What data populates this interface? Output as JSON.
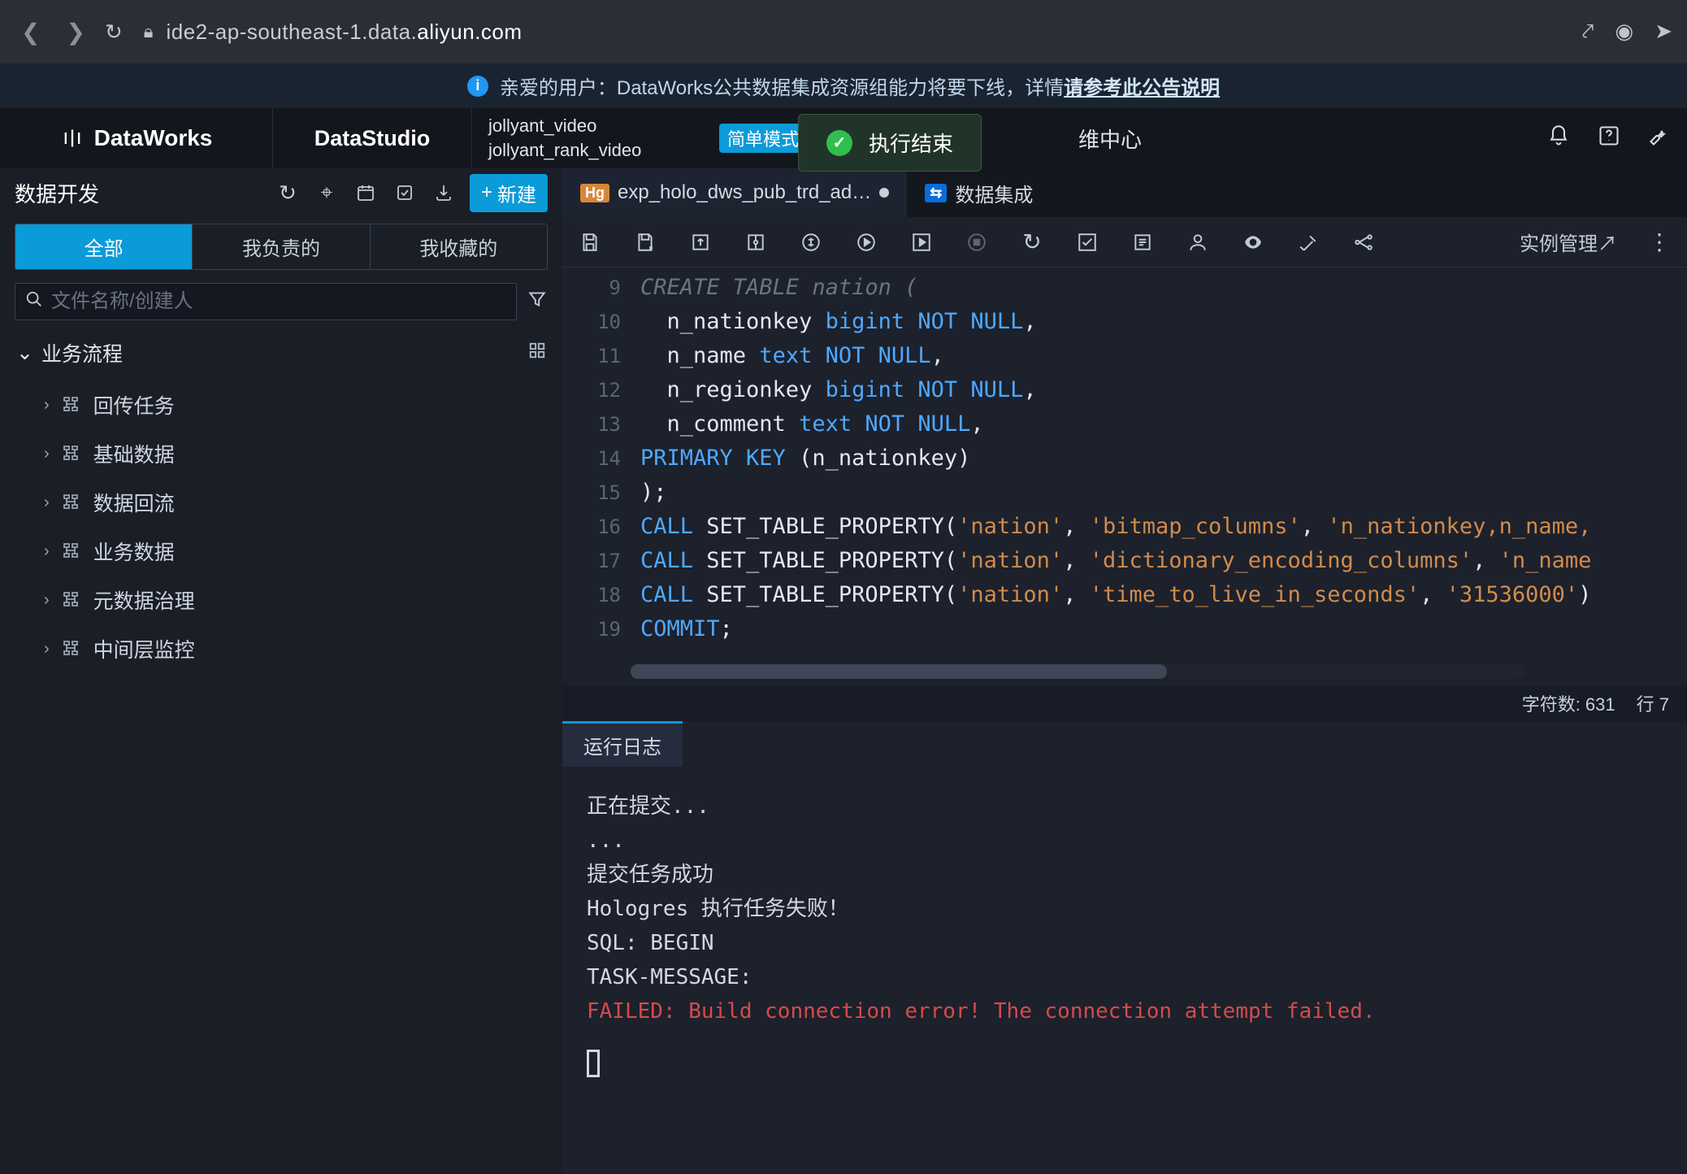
{
  "browser": {
    "url_prefix": "ide2-ap-southeast-1.data.",
    "url_domain": "aliyun.com"
  },
  "notice": {
    "prefix": "亲爱的用户：DataWorks公共数据集成资源组能力将要下线，详情",
    "link": "请参考此公告说明"
  },
  "header": {
    "brand": "DataWorks",
    "studio": "DataStudio",
    "project_line1": "jollyant_video",
    "project_line2": "jollyant_rank_video",
    "mode": "简单模式",
    "nav_center": "维中心"
  },
  "toast": "执行结束",
  "sidebar": {
    "title": "数据开发",
    "new_btn": "新建",
    "tabs": {
      "all": "全部",
      "mine": "我负责的",
      "fav": "我收藏的"
    },
    "search_placeholder": "文件名称/创建人",
    "tree_title": "业务流程",
    "items": [
      {
        "label": "回传任务"
      },
      {
        "label": "基础数据"
      },
      {
        "label": "数据回流"
      },
      {
        "label": "业务数据"
      },
      {
        "label": "元数据治理"
      },
      {
        "label": "中间层监控"
      }
    ]
  },
  "tabs": {
    "file1": "exp_holo_dws_pub_trd_ad…",
    "file1_badge": "Hg",
    "file2": "数据集成"
  },
  "editor": {
    "instance_link": "实例管理↗",
    "lines": [
      {
        "n": "9",
        "segs": [
          {
            "t": "fade",
            "v": "CREATE TABLE nation ("
          }
        ]
      },
      {
        "n": "10",
        "segs": [
          {
            "t": "id",
            "v": "  n_nationkey "
          },
          {
            "t": "kw",
            "v": "bigint "
          },
          {
            "t": "kw",
            "v": "NOT NULL"
          },
          {
            "t": "pun",
            "v": ","
          }
        ]
      },
      {
        "n": "11",
        "segs": [
          {
            "t": "id",
            "v": "  n_name "
          },
          {
            "t": "kw",
            "v": "text "
          },
          {
            "t": "kw",
            "v": "NOT NULL"
          },
          {
            "t": "pun",
            "v": ","
          }
        ]
      },
      {
        "n": "12",
        "segs": [
          {
            "t": "id",
            "v": "  n_regionkey "
          },
          {
            "t": "kw",
            "v": "bigint "
          },
          {
            "t": "kw",
            "v": "NOT NULL"
          },
          {
            "t": "pun",
            "v": ","
          }
        ]
      },
      {
        "n": "13",
        "segs": [
          {
            "t": "id",
            "v": "  n_comment "
          },
          {
            "t": "kw",
            "v": "text "
          },
          {
            "t": "kw",
            "v": "NOT NULL"
          },
          {
            "t": "pun",
            "v": ","
          }
        ]
      },
      {
        "n": "14",
        "segs": [
          {
            "t": "kw",
            "v": "PRIMARY KEY "
          },
          {
            "t": "pun",
            "v": "(n_nationkey)"
          }
        ]
      },
      {
        "n": "15",
        "segs": [
          {
            "t": "pun",
            "v": ");"
          }
        ]
      },
      {
        "n": "16",
        "segs": [
          {
            "t": "kw",
            "v": "CALL "
          },
          {
            "t": "id",
            "v": "SET_TABLE_PROPERTY("
          },
          {
            "t": "str",
            "v": "'nation'"
          },
          {
            "t": "pun",
            "v": ", "
          },
          {
            "t": "str",
            "v": "'bitmap_columns'"
          },
          {
            "t": "pun",
            "v": ", "
          },
          {
            "t": "str",
            "v": "'n_nationkey,n_name,"
          }
        ]
      },
      {
        "n": "17",
        "segs": [
          {
            "t": "kw",
            "v": "CALL "
          },
          {
            "t": "id",
            "v": "SET_TABLE_PROPERTY("
          },
          {
            "t": "str",
            "v": "'nation'"
          },
          {
            "t": "pun",
            "v": ", "
          },
          {
            "t": "str",
            "v": "'dictionary_encoding_columns'"
          },
          {
            "t": "pun",
            "v": ", "
          },
          {
            "t": "str",
            "v": "'n_name"
          }
        ]
      },
      {
        "n": "18",
        "segs": [
          {
            "t": "kw",
            "v": "CALL "
          },
          {
            "t": "id",
            "v": "SET_TABLE_PROPERTY("
          },
          {
            "t": "str",
            "v": "'nation'"
          },
          {
            "t": "pun",
            "v": ", "
          },
          {
            "t": "str",
            "v": "'time_to_live_in_seconds'"
          },
          {
            "t": "pun",
            "v": ", "
          },
          {
            "t": "str",
            "v": "'31536000'"
          },
          {
            "t": "pun",
            "v": ")"
          }
        ]
      },
      {
        "n": "19",
        "segs": [
          {
            "t": "kw",
            "v": "COMMIT"
          },
          {
            "t": "pun",
            "v": ";"
          }
        ]
      }
    ],
    "status_chars": "字符数: 631",
    "status_row": "行 7"
  },
  "console": {
    "tab": "运行日志",
    "lines": [
      {
        "cls": "",
        "text": "正在提交..."
      },
      {
        "cls": "",
        "text": "..."
      },
      {
        "cls": "",
        "text": "提交任务成功"
      },
      {
        "cls": "",
        "text": "Hologres 执行任务失败！"
      },
      {
        "cls": "",
        "text": "SQL: BEGIN"
      },
      {
        "cls": "",
        "text": "TASK-MESSAGE:"
      },
      {
        "cls": "err",
        "text": "FAILED: Build connection error! The connection attempt failed."
      }
    ]
  }
}
